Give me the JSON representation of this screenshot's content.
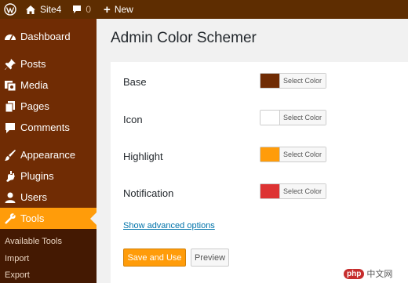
{
  "adminbar": {
    "site_name": "Site4",
    "comments_count": "0",
    "new_label": "New"
  },
  "sidebar": {
    "items": [
      {
        "label": "Dashboard",
        "icon": "dashboard-icon"
      },
      {
        "label": "Posts",
        "icon": "pin-icon"
      },
      {
        "label": "Media",
        "icon": "media-icon"
      },
      {
        "label": "Pages",
        "icon": "pages-icon"
      },
      {
        "label": "Comments",
        "icon": "comment-icon"
      },
      {
        "label": "Appearance",
        "icon": "paintbrush-icon"
      },
      {
        "label": "Plugins",
        "icon": "plugin-icon"
      },
      {
        "label": "Users",
        "icon": "user-icon"
      },
      {
        "label": "Tools",
        "icon": "wrench-icon",
        "current": true
      }
    ],
    "submenu": [
      "Available Tools",
      "Import",
      "Export"
    ]
  },
  "page": {
    "title": "Admin Color Schemer",
    "colors": [
      {
        "label": "Base",
        "button": "Select Color",
        "swatch": "#702c04"
      },
      {
        "label": "Icon",
        "button": "Select Color",
        "swatch": "#ffffff"
      },
      {
        "label": "Highlight",
        "button": "Select Color",
        "swatch": "#ff9c0a"
      },
      {
        "label": "Notification",
        "button": "Select Color",
        "swatch": "#dd3333"
      }
    ],
    "advanced_link": "Show advanced options",
    "save_label": "Save and Use",
    "preview_label": "Preview"
  },
  "watermark": {
    "badge": "php",
    "text": "中文网"
  },
  "theme": {
    "adminbar_bg": "#5e2d01",
    "sidebar_bg": "#702c04",
    "submenu_bg": "#441902",
    "highlight": "#ff9c0a",
    "link": "#0073aa"
  }
}
